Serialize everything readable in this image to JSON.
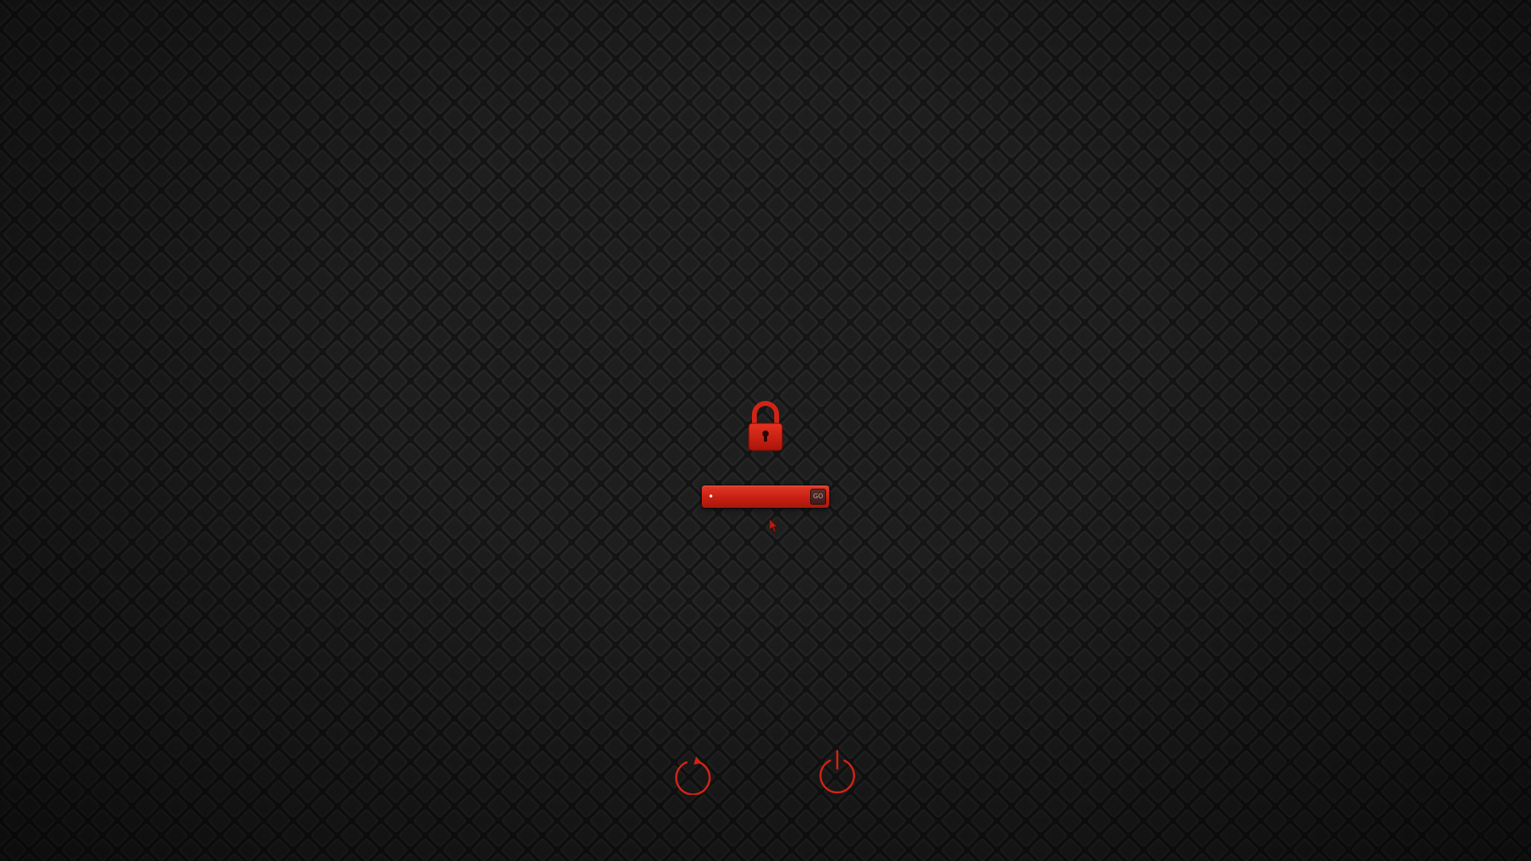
{
  "lock_screen": {
    "lock_icon": "padlock-icon",
    "accent_color": "#d42616",
    "password": {
      "value": "•",
      "placeholder": "",
      "submit_label": "GO"
    },
    "restart": {
      "icon": "restart-icon"
    },
    "shutdown": {
      "icon": "power-icon"
    }
  }
}
